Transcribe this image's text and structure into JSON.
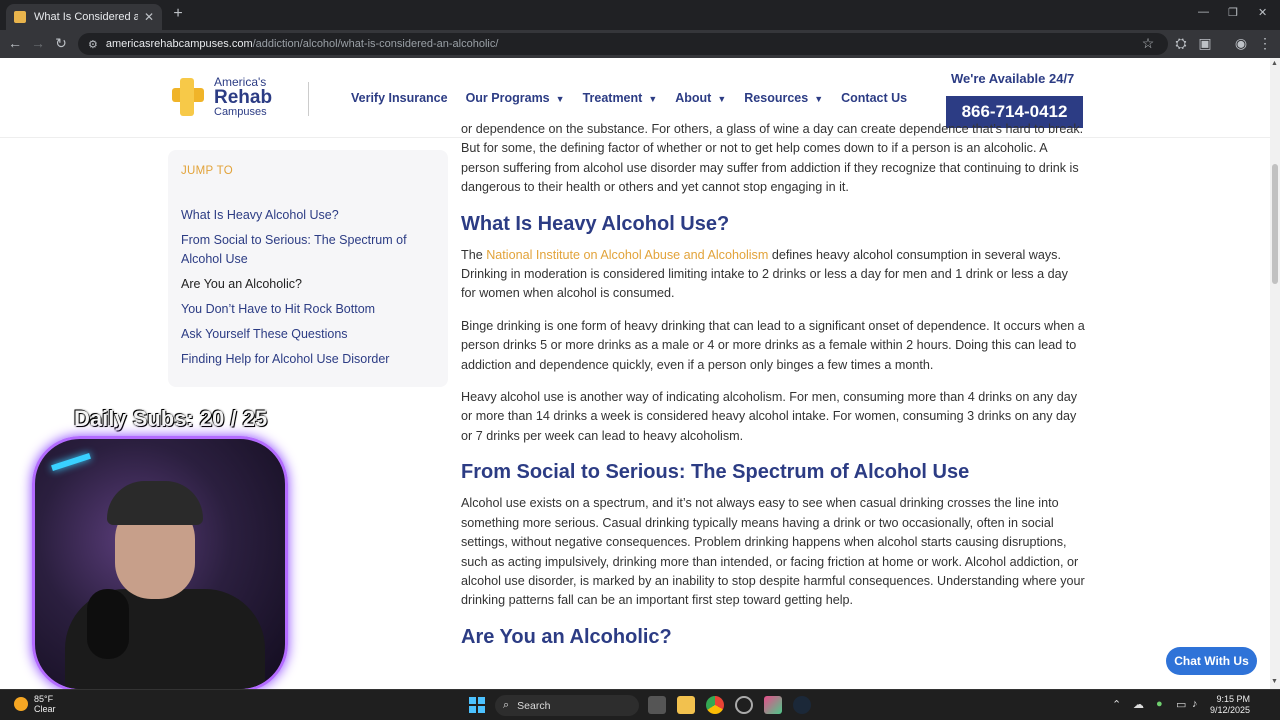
{
  "browser": {
    "tab_title": "What Is Considered an Alcoholic?",
    "tab_close": "✕",
    "new_tab": "+",
    "url_host": "americasrehabcampuses.com",
    "url_path": "/addiction/alcohol/what-is-considered-an-alcoholic/",
    "window_controls": [
      "—",
      "❐",
      "✕"
    ]
  },
  "header": {
    "logo": {
      "line1": "America's",
      "line2": "Rehab",
      "line3": "Campuses"
    },
    "nav": [
      {
        "label": "Verify Insurance",
        "caret": false
      },
      {
        "label": "Our Programs",
        "caret": true
      },
      {
        "label": "Treatment",
        "caret": true
      },
      {
        "label": "About",
        "caret": true
      },
      {
        "label": "Resources",
        "caret": true
      },
      {
        "label": "Contact Us",
        "caret": false
      }
    ],
    "available": "We're Available 24/7",
    "phone": "866-714-0412"
  },
  "jump_to": {
    "title": "JUMP TO",
    "items": [
      "What Is Heavy Alcohol Use?",
      "From Social to Serious: The Spectrum of Alcohol Use",
      "Are You an Alcoholic?",
      "You Don’t Have to Hit Rock Bottom",
      "Ask Yourself These Questions",
      "Finding Help for Alcohol Use Disorder"
    ],
    "active_index": 2
  },
  "article": {
    "intro_cut": "or dependence on the substance. For others, a glass of wine a day can create dependence that’s hard to break. But for some, the defining factor of whether or not to get help comes down to if a person is an alcoholic. A person suffering from alcohol use disorder may suffer from addiction if they recognize that continuing to drink is dangerous to their health or others and yet cannot stop engaging in it.",
    "h_heavy": "What Is Heavy Alcohol Use?",
    "p_heavy_1_pre": "The ",
    "p_heavy_1_link": "National Institute on Alcohol Abuse and Alcoholism",
    "p_heavy_1_post": " defines heavy alcohol consumption in several ways. Drinking in moderation is considered limiting intake to 2 drinks or less a day for men and 1 drink or less a day for women when alcohol is consumed.",
    "p_heavy_2": "Binge drinking is one form of heavy drinking that can lead to a significant onset of dependence. It occurs when a person drinks 5 or more drinks as a male or 4 or more drinks as a female within 2 hours. Doing this can lead to addiction and dependence quickly, even if a person only binges a few times a month.",
    "p_heavy_3": "Heavy alcohol use is another way of indicating alcoholism. For men, consuming more than 4 drinks on any day or more than 14 drinks a week is considered heavy alcohol intake. For women, consuming 3 drinks on any day or 7 drinks per week can lead to heavy alcoholism.",
    "h_spectrum": "From Social to Serious: The Spectrum of Alcohol Use",
    "p_spectrum": "Alcohol use exists on a spectrum, and it’s not always easy to see when casual drinking crosses the line into something more serious. Casual drinking typically means having a drink or two occasionally, often in social settings, without negative consequences. Problem drinking happens when alcohol starts causing disruptions, such as acting impulsively, drinking more than intended, or facing friction at home or work. Alcohol addiction, or alcohol use disorder, is marked by an inability to stop despite harmful consequences. Understanding where your drinking patterns fall can be an important first step toward getting help.",
    "h_alcoholic": "Are You an Alcoholic?"
  },
  "overlay": {
    "daily_subs": "Daily Subs:  20 / 25"
  },
  "chat_button": "Chat With Us",
  "taskbar": {
    "weather_temp": "85°F",
    "weather_desc": "Clear",
    "search": "Search",
    "time": "9:15 PM",
    "date": "9/12/2025"
  }
}
